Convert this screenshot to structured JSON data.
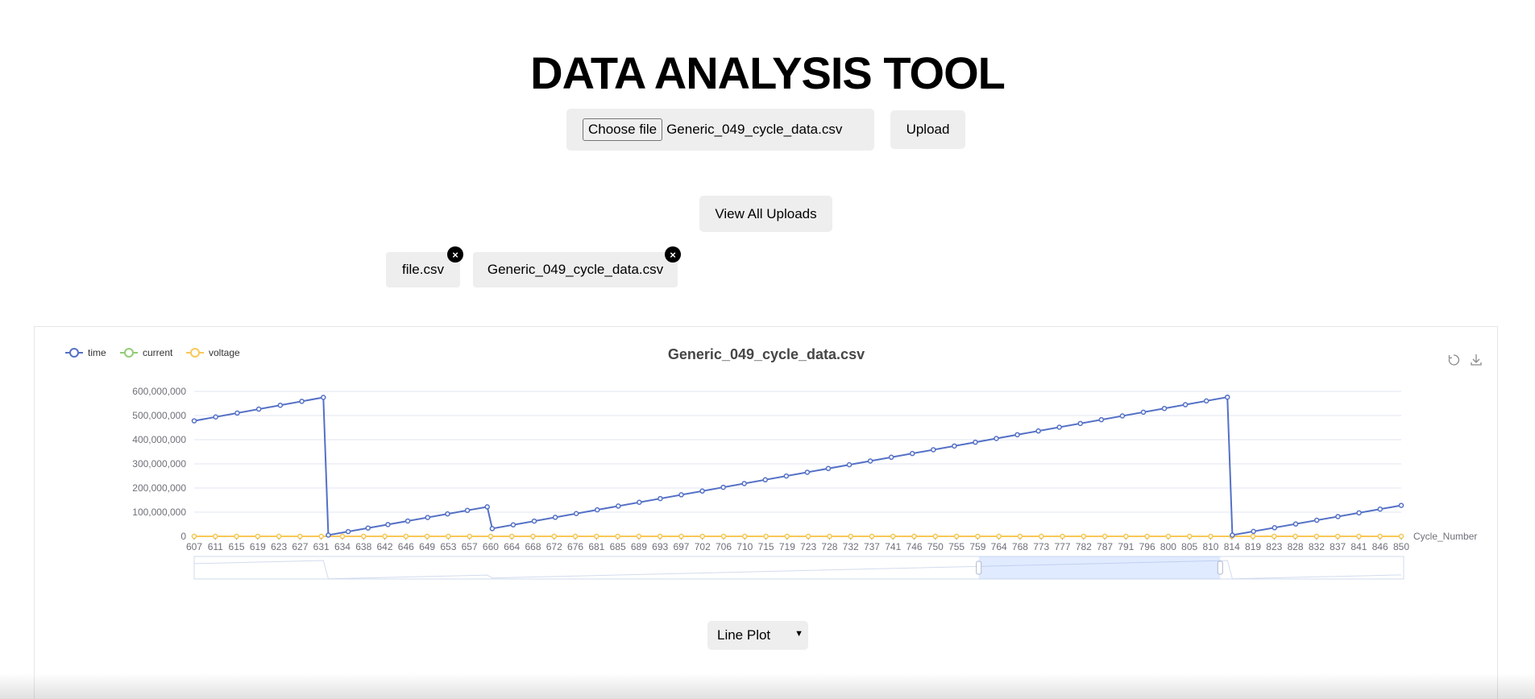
{
  "header": {
    "title": "DATA ANALYSIS TOOL"
  },
  "upload": {
    "choose_label": "Choose file",
    "selected_file": "Generic_049_cycle_data.csv",
    "upload_label": "Upload"
  },
  "view_all_label": "View All Uploads",
  "files": [
    {
      "name": "file.csv",
      "remove_label": "×"
    },
    {
      "name": "Generic_049_cycle_data.csv",
      "remove_label": "×"
    }
  ],
  "plot_type": {
    "selected": "Line Plot"
  },
  "chart_data": {
    "type": "line",
    "title": "Generic_049_cycle_data.csv",
    "xlabel": "Cycle_Number",
    "ylabel": "",
    "ylim": [
      0,
      600000000
    ],
    "yticks": [
      "0",
      "100,000,000",
      "200,000,000",
      "300,000,000",
      "400,000,000",
      "500,000,000",
      "600,000,000"
    ],
    "xticks": [
      "607",
      "611",
      "615",
      "619",
      "623",
      "627",
      "631",
      "634",
      "638",
      "642",
      "646",
      "649",
      "653",
      "657",
      "660",
      "664",
      "668",
      "672",
      "676",
      "681",
      "685",
      "689",
      "693",
      "697",
      "702",
      "706",
      "710",
      "715",
      "719",
      "723",
      "728",
      "732",
      "737",
      "741",
      "746",
      "750",
      "755",
      "759",
      "764",
      "768",
      "773",
      "777",
      "782",
      "787",
      "791",
      "796",
      "800",
      "805",
      "810",
      "814",
      "819",
      "823",
      "828",
      "832",
      "837",
      "841",
      "846",
      "850"
    ],
    "legend_position": "top-left",
    "grid": true,
    "colors": {
      "time": "#5470c6",
      "current": "#91cc75",
      "voltage": "#fac858"
    },
    "series": [
      {
        "name": "time",
        "segments": [
          {
            "x_start": 607,
            "x_end": 633,
            "y_start": 478000000,
            "y_end": 575000000
          },
          {
            "x_start": 634,
            "x_end": 666,
            "y_start": 5000000,
            "y_end": 122000000
          },
          {
            "x_start": 667,
            "x_end": 815,
            "y_start": 32000000,
            "y_end": 576000000
          },
          {
            "x_start": 816,
            "x_end": 850,
            "y_start": 5000000,
            "y_end": 128000000
          }
        ]
      },
      {
        "name": "current",
        "constant": 0
      },
      {
        "name": "voltage",
        "constant": 0
      }
    ],
    "zoom_range": {
      "start_pct": 65,
      "end_pct": 85
    }
  }
}
